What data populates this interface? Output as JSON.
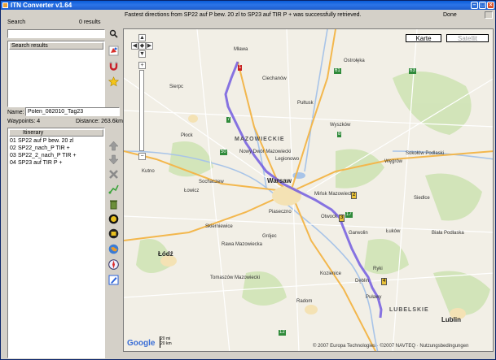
{
  "window": {
    "title": "ITN Converter v1.64"
  },
  "search": {
    "label": "Search",
    "count": "0 results",
    "value": "",
    "results_header": "Search results"
  },
  "route": {
    "name_label": "Name:",
    "name_value": "Polen_082010_Tag23",
    "waypoints": "Waypoints: 4",
    "distance": "Distance: 263.6km"
  },
  "itinerary": {
    "header": "Itinerary",
    "rows": [
      {
        "n": "01",
        "label": "SP22 auf P bew. 20 zl"
      },
      {
        "n": "02",
        "label": "SP22_nach_P TIR +"
      },
      {
        "n": "03",
        "label": "SP22_2_nach_P TIR +"
      },
      {
        "n": "04",
        "label": "SP23 auf TIR P +"
      }
    ]
  },
  "status": {
    "message": "Fastest directions from SP22 auf P bew. 20 zl to SP23 auf TIR P + was successfully retrieved.",
    "state": "Done"
  },
  "map": {
    "type_buttons": [
      "Karte",
      "Satellit"
    ],
    "selected_type": "Karte",
    "cities_major": [
      "Warsaw",
      "Łódź",
      "Lublin"
    ],
    "cities": [
      "Płock",
      "Ciechanów",
      "Pułtusk",
      "Wyszków",
      "Siedlce",
      "Radom",
      "Puławy",
      "Mińsk Mazowiecki",
      "Legionowo",
      "Nowy Dwór Mazowiecki",
      "Sochaczew",
      "Skierniewice",
      "Piaseczno",
      "Garwolin",
      "Ryki",
      "Dęblin",
      "Kozienice",
      "Ostrołęka",
      "Mława",
      "Sierpc",
      "Rawa Mazowiecka",
      "Tomaszów Mazowiecki",
      "Biała Podlaska",
      "Łuków",
      "Łowicz",
      "Kutno",
      "Grójec",
      "Otwock",
      "Węgrów",
      "Sokołów Podlaski"
    ],
    "regions": [
      "MAZOWIECKIE",
      "LUBELSKIE"
    ],
    "road_numbers": [
      "7",
      "50",
      "61",
      "63",
      "8",
      "17",
      "12"
    ],
    "waypoint_markers": [
      "1",
      "2",
      "3",
      "4"
    ],
    "copyright": "© 2007 Europa Technologies · ©2007 NAVTEQ · Nutzungsbedingungen",
    "logo": "Google",
    "scale_top": "20 mi",
    "scale_bottom": "20 km",
    "terms": "Nutzungsbedingungen"
  },
  "colors": {
    "route": "#6a52e0",
    "titlebar": "#0a5bd8",
    "map_bg": "#f2efe6",
    "forest": "#cfe3b5",
    "water": "#a8c4e8",
    "highway": "#f3b74d"
  },
  "icons": [
    "search-icon",
    "google-earth-icon",
    "magnet-icon",
    "star-icon",
    "arrow-up-icon",
    "arrow-down-icon",
    "delete-icon",
    "route-icon",
    "globe-icon",
    "compass-icon",
    "edit-icon"
  ]
}
